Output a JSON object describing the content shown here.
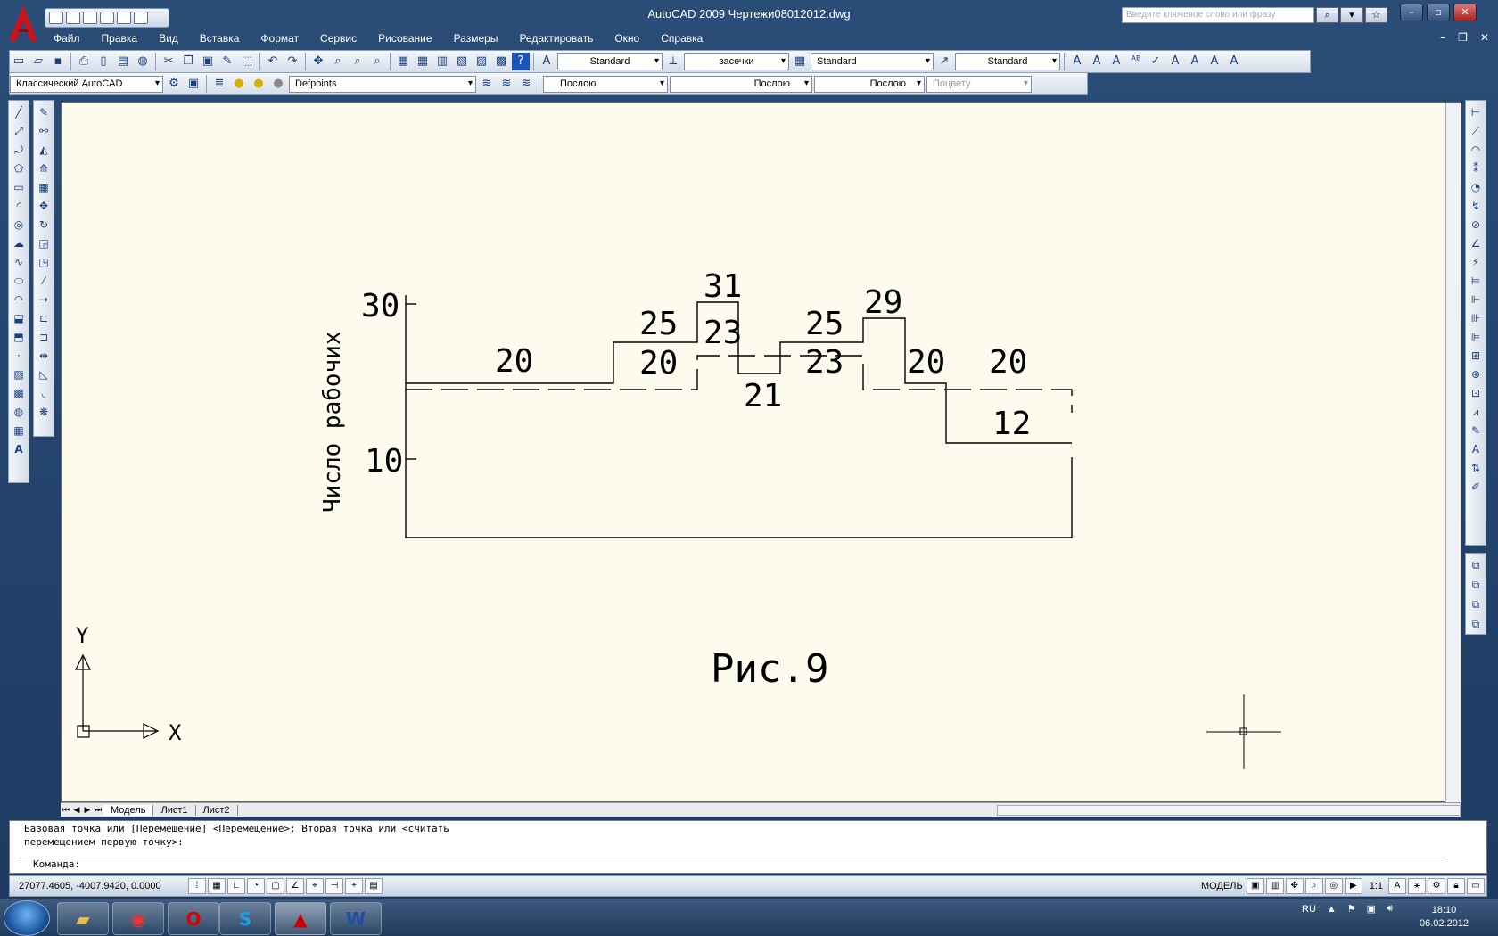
{
  "window": {
    "title": "AutoCAD 2009 Чертежи08012012.dwg",
    "search_placeholder": "Введите ключевое слово или фразу"
  },
  "menu": [
    "Файл",
    "Правка",
    "Вид",
    "Вставка",
    "Формат",
    "Сервис",
    "Рисование",
    "Размеры",
    "Редактировать",
    "Окно",
    "Справка"
  ],
  "toolbar1": {
    "text_style": "Standard",
    "dim_style": "засечки",
    "table_style": "Standard",
    "mleader_style": "Standard"
  },
  "toolbar2": {
    "workspace": "Классический AutoCAD",
    "layer": "Defpoints",
    "color": "Послою",
    "linetype": "Послою",
    "lineweight": "Послою",
    "plotstyle": "Поцвету"
  },
  "drawing": {
    "y_axis_label": "Число рабочих",
    "tick_30": "30",
    "tick_10": "10",
    "labels": [
      "20",
      "25",
      "31",
      "23",
      "20",
      "21",
      "25",
      "23",
      "29",
      "20",
      "20",
      "12"
    ],
    "caption": "Рис.9",
    "ucs_x": "X",
    "ucs_y": "Y"
  },
  "tabs": [
    "Модель",
    "Лист1",
    "Лист2"
  ],
  "command": {
    "line1": "Базовая точка или [Перемещение] <Перемещение>: Вторая точка или <считать",
    "line2": "перемещением первую точку>:",
    "prompt": "Команда:"
  },
  "status": {
    "coords": "27077.4605, -4007.9420, 0.0000",
    "model": "МОДЕЛЬ",
    "scale": "1:1"
  },
  "taskbar": {
    "lang": "RU",
    "time": "18:10",
    "date": "06.02.2012"
  }
}
